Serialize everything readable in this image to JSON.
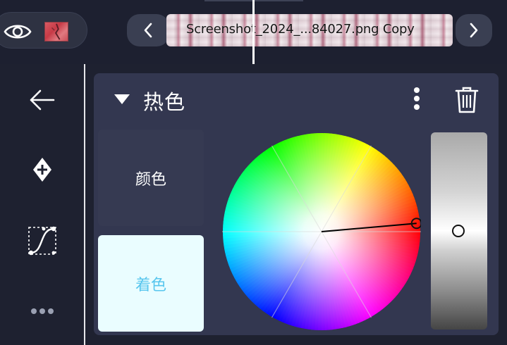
{
  "topbar": {
    "visibility_icon": "eye-icon",
    "layer_thumb_icon": "layer-thumbnail",
    "prev_icon": "chevron-left-icon",
    "next_icon": "chevron-right-icon",
    "clip_label": "Screenshot_2024_...84027.png Copy"
  },
  "tools": {
    "back_icon": "arrow-left-icon",
    "add_keyframe_icon": "diamond-plus-icon",
    "curve_icon": "bezier-curve-icon",
    "more_icon": "more-horizontal-icon"
  },
  "panel": {
    "title": "热色",
    "menu_icon": "kebab-menu-icon",
    "delete_icon": "trash-icon",
    "tabs": {
      "color_label": "颜色",
      "tint_label": "着色"
    },
    "wheel": {
      "hue_deg": 5,
      "saturation": 0.98
    },
    "brightness_level": 0.5
  },
  "colors": {
    "background": "#1e2130",
    "panel": "#333750",
    "tint_active_bg": "#eafdff",
    "tint_active_text": "#58c6ee"
  }
}
